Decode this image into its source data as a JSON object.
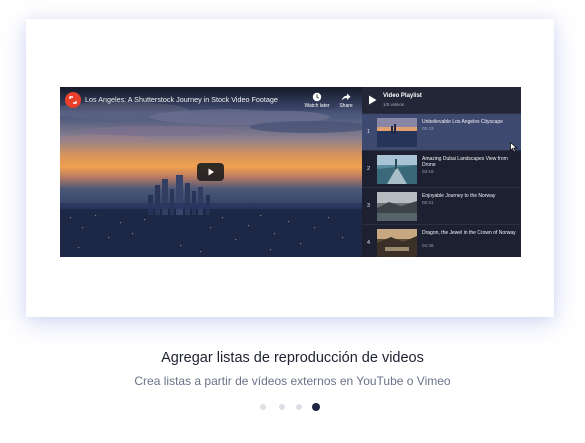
{
  "video": {
    "title": "Los Angeles: A Shutterstock Journey in Stock Video Footage",
    "watch_later_label": "Watch later",
    "share_label": "Share"
  },
  "playlist": {
    "title": "Video Playlist",
    "count": "1/5 videos",
    "items": [
      {
        "num": "1",
        "title": "Unbelievable Los Angeles Cityscape",
        "duration": "00:43"
      },
      {
        "num": "2",
        "title": "Amazing Dubai Landscapes View from Drone",
        "duration": "03:16"
      },
      {
        "num": "3",
        "title": "Enjoyable Journey to the Norway",
        "duration": "00:31"
      },
      {
        "num": "4",
        "title": "Dragon, the Jewel in the Crown of Norway",
        "duration": "04:46"
      }
    ]
  },
  "slide": {
    "title": "Agregar listas de reproducción de videos",
    "subtitle": "Crea listas a partir de vídeos externos en YouTube o Vimeo"
  },
  "carousel": {
    "active_index": 4,
    "total": 4
  },
  "colors": {
    "accent_dark": "#1f2540",
    "playlist_bg": "#1d2030",
    "active_item": "#3e4970",
    "logo_red": "#e8402a"
  }
}
